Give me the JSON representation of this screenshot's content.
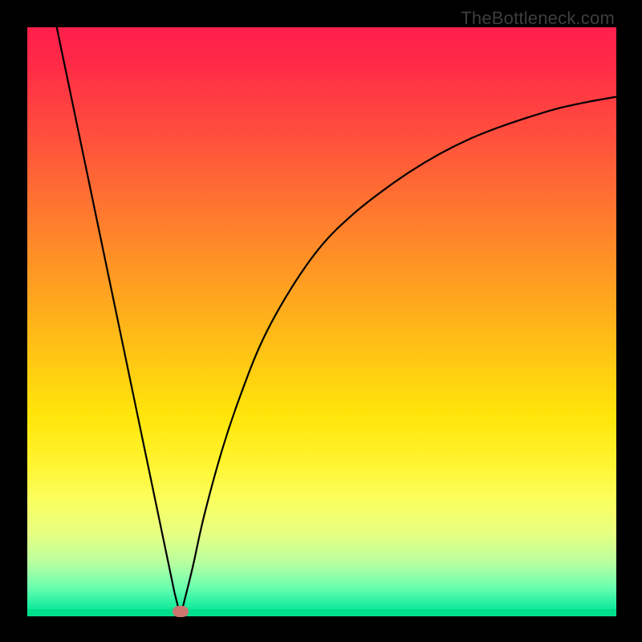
{
  "attribution": "TheBottleneck.com",
  "chart_data": {
    "type": "line",
    "title": "",
    "xlabel": "",
    "ylabel": "",
    "xlim": [
      0,
      100
    ],
    "ylim": [
      0,
      100
    ],
    "grid": false,
    "legend": false,
    "series": [
      {
        "name": "left-descending",
        "x": [
          5,
          10,
          15,
          20,
          25,
          26
        ],
        "values": [
          100,
          76,
          52,
          28,
          4,
          0
        ]
      },
      {
        "name": "right-ascending",
        "x": [
          26,
          28,
          30,
          33,
          36,
          40,
          45,
          50,
          55,
          60,
          65,
          70,
          75,
          80,
          85,
          90,
          95,
          100
        ],
        "values": [
          0,
          8,
          17,
          28,
          37,
          47,
          56,
          63,
          68,
          72,
          75.5,
          78.5,
          81,
          83,
          84.7,
          86.2,
          87.3,
          88.2
        ]
      }
    ],
    "marker": {
      "x": 26,
      "y": 0,
      "color": "#cb766f"
    },
    "background_gradient": {
      "top": "#ff1f4b",
      "mid": "#ffe60a",
      "bottom": "#00e08c"
    },
    "frame_color": "#000000"
  }
}
